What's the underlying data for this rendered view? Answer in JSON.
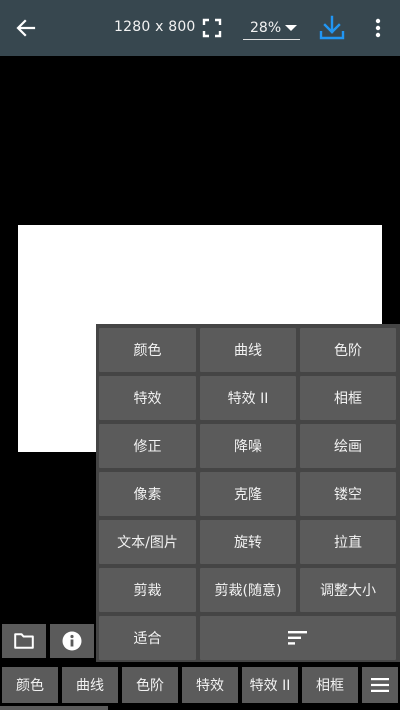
{
  "header": {
    "dimensions": "1280 x 800",
    "zoom": "28%",
    "icons": {
      "back": "arrow-left-icon",
      "fullscreen": "fullscreen-icon",
      "zoom_dropdown": "caret-down-icon",
      "download": "download-icon",
      "more": "more-vertical-icon"
    },
    "accent_color": "#2196f3"
  },
  "menu": {
    "items": [
      "颜色",
      "曲线",
      "色阶",
      "特效",
      "特效 II",
      "相框",
      "修正",
      "降噪",
      "绘画",
      "像素",
      "克隆",
      "镂空",
      "文本/图片",
      "旋转",
      "拉直",
      "剪裁",
      "剪裁(随意)",
      "调整大小",
      "适合"
    ],
    "sort_icon": "sort-icon"
  },
  "side_buttons": {
    "folder_icon": "folder-icon",
    "info_icon": "info-icon"
  },
  "bottom_tabs": [
    "颜色",
    "曲线",
    "色阶",
    "特效",
    "特效 II",
    "相框"
  ],
  "bottom_menu_icon": "hamburger-menu-icon",
  "colors": {
    "toolbar": "#37474f",
    "button": "#5b5b5b",
    "panel": "#454545",
    "background": "#000000"
  }
}
